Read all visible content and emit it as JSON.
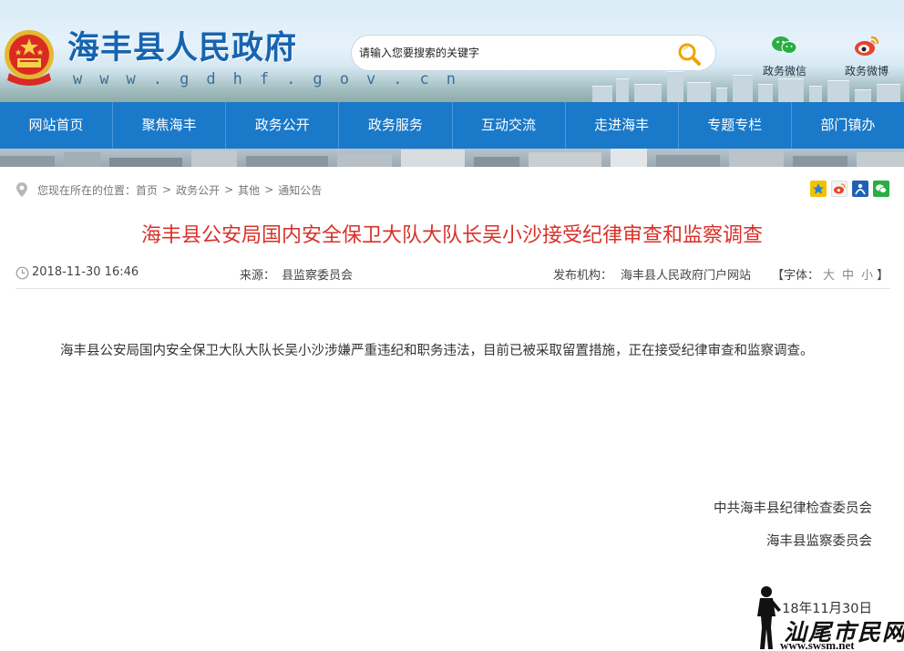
{
  "header": {
    "site_title": "海丰县人民政府",
    "site_url": "w w w . g d h f . g o v . c n",
    "search_placeholder": "请输入您要搜索的关键字",
    "social": [
      {
        "label": "政务微信",
        "icon": "wechat-icon"
      },
      {
        "label": "政务微博",
        "icon": "weibo-icon"
      }
    ]
  },
  "nav": {
    "items": [
      "网站首页",
      "聚焦海丰",
      "政务公开",
      "政务服务",
      "互动交流",
      "走进海丰",
      "专题专栏",
      "部门镇办"
    ]
  },
  "breadcrumb": {
    "prefix": "您现在所在的位置：",
    "items": [
      "首页",
      "政务公开",
      "其他",
      "通知公告"
    ],
    "separator": ">"
  },
  "share_icons": [
    "qzone-icon",
    "weibo-share-icon",
    "renren-icon",
    "wechat-share-icon"
  ],
  "article": {
    "title": "海丰县公安局国内安全保卫大队大队长吴小沙接受纪律审查和监察调查",
    "date": "2018-11-30 16:46",
    "source_label": "来源：",
    "source": "县监察委员会",
    "publisher_label": "发布机构：",
    "publisher": "海丰县人民政府门户网站",
    "font_label_open": "【字体：",
    "font_sizes": [
      "大",
      "中",
      "小"
    ],
    "font_label_close": "】",
    "body": "海丰县公安局国内安全保卫大队大队长吴小沙涉嫌严重违纪和职务违法，目前已被采取留置措施，正在接受纪律审查和监察调查。",
    "signature_1": "中共海丰县纪律检查委员会",
    "signature_2": "海丰县监察委员会",
    "signature_date": "18年11月30日"
  },
  "watermark": {
    "text": "汕尾市民网",
    "url": "www.swsm.net"
  },
  "colors": {
    "nav_bg": "#1a79c9",
    "title_red": "#d8312a",
    "brand_blue": "#1764b0"
  }
}
